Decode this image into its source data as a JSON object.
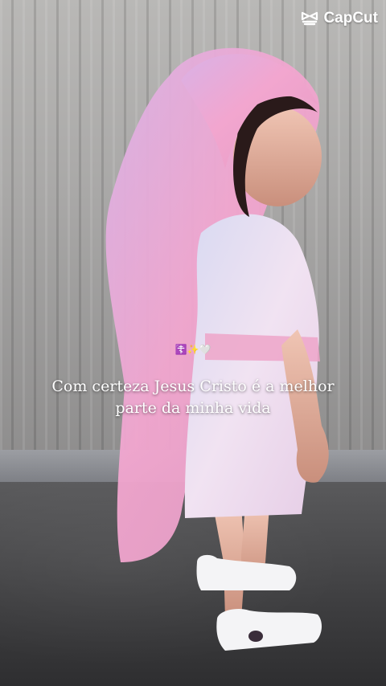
{
  "watermark": {
    "label": "CapCut",
    "icon": "capcut-logo-icon"
  },
  "overlay": {
    "emoji_line": "☦️✨🤍",
    "caption": "Com certeza Jesus Cristo é a melhor parte da minha vida"
  },
  "colors": {
    "veil_pink": "#f0a8cf",
    "dress_lavender": "#e8d7f0",
    "caption_text": "#ffffff"
  }
}
